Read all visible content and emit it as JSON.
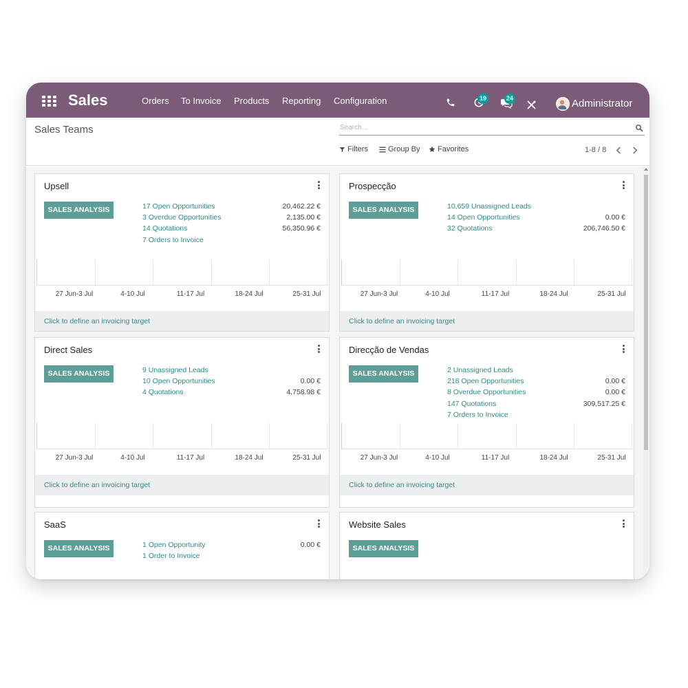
{
  "navbar": {
    "app_title": "Sales",
    "menu": [
      "Orders",
      "To Invoice",
      "Products",
      "Reporting",
      "Configuration"
    ],
    "activity_badge": "19",
    "messages_badge": "24",
    "user_name": "Administrator"
  },
  "control_panel": {
    "breadcrumb": "Sales Teams",
    "search_placeholder": "Search...",
    "filters_label": "Filters",
    "group_by_label": "Group By",
    "favorites_label": "Favorites",
    "pager": "1-8 / 8"
  },
  "graph_ticks": [
    "27 Jun-3 Jul",
    "4-10 Jul",
    "11-17 Jul",
    "18-24 Jul",
    "25-31 Jul"
  ],
  "cards": [
    {
      "title": "Upsell",
      "button": "SALES ANALYSIS",
      "stats": [
        {
          "label": "17 Open Opportunities",
          "value": "20,462.22 €"
        },
        {
          "label": "3 Overdue Opportunities",
          "value": "2,135.00 €"
        },
        {
          "label": "14 Quotations",
          "value": "56,350.96 €"
        },
        {
          "label": "7 Orders to Invoice",
          "value": ""
        }
      ],
      "footer": "Click to define an invoicing target"
    },
    {
      "title": "Prospecção",
      "button": "SALES ANALYSIS",
      "stats": [
        {
          "label": "10,659 Unassigned Leads",
          "value": ""
        },
        {
          "label": "14 Open Opportunities",
          "value": "0.00 €"
        },
        {
          "label": "32 Quotations",
          "value": "206,746.50 €"
        }
      ],
      "footer": "Click to define an invoicing target"
    },
    {
      "title": "Direct Sales",
      "button": "SALES ANALYSIS",
      "stats": [
        {
          "label": "9 Unassigned Leads",
          "value": ""
        },
        {
          "label": "10 Open Opportunities",
          "value": "0.00 €"
        },
        {
          "label": "4 Quotations",
          "value": "4,758.98 €"
        }
      ],
      "footer": "Click to define an invoicing target"
    },
    {
      "title": "Direcção de Vendas",
      "button": "SALES ANALYSIS",
      "stats": [
        {
          "label": "2 Unassigned Leads",
          "value": ""
        },
        {
          "label": "218 Open Opportunities",
          "value": "0.00 €"
        },
        {
          "label": "8 Overdue Opportunities",
          "value": "0.00 €"
        },
        {
          "label": "147 Quotations",
          "value": "309,517.25 €"
        },
        {
          "label": "7 Orders to Invoice",
          "value": ""
        }
      ],
      "footer": "Click to define an invoicing target"
    },
    {
      "title": "SaaS",
      "button": "SALES ANALYSIS",
      "stats": [
        {
          "label": "1 Open Opportunity",
          "value": "0.00 €"
        },
        {
          "label": "1 Order to Invoice",
          "value": ""
        }
      ],
      "footer": ""
    },
    {
      "title": "Website Sales",
      "button": "SALES ANALYSIS",
      "stats": [],
      "footer": ""
    }
  ],
  "colors": {
    "navbar": "#7c5b78",
    "accent": "#5e9e98",
    "link": "#2d8c87",
    "badge": "#00a09d"
  }
}
